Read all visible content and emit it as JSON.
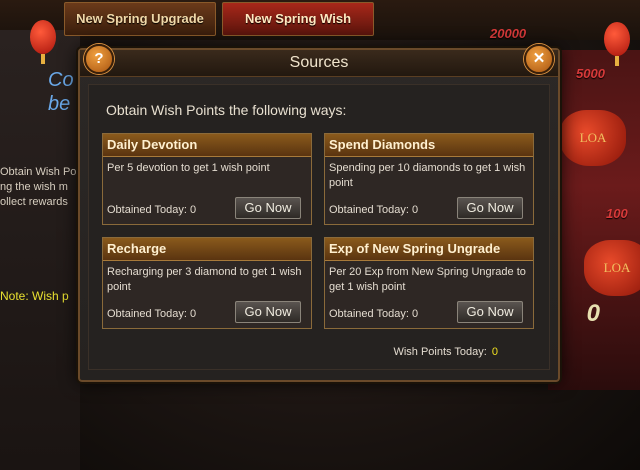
{
  "tabs": [
    {
      "label": "New Spring Upgrade"
    },
    {
      "label": "New Spring Wish"
    }
  ],
  "background": {
    "top_number": "20000",
    "side_number_1": "5000",
    "side_number_2": "100",
    "big_zero": "0",
    "bag_label": "LOA",
    "co_line1": "Co",
    "co_line2": "be",
    "left_text_1": "Obtain Wish Po",
    "left_text_2": "ng the wish m",
    "left_text_3": "ollect rewards",
    "note": "Note: Wish p"
  },
  "dialog": {
    "title": "Sources",
    "help_label": "?",
    "close_label": "✕",
    "subtitle": "Obtain Wish Points the following ways:",
    "cards": [
      {
        "title": "Daily Devotion",
        "description": "Per 5 devotion to get 1 wish point",
        "obtained": "Obtained Today: 0",
        "button": "Go Now"
      },
      {
        "title": "Spend Diamonds",
        "description": "Spending per 10 diamonds to get 1 wish point",
        "obtained": "Obtained Today: 0",
        "button": "Go Now"
      },
      {
        "title": "Recharge",
        "description": "Recharging per 3 diamond to get 1 wish point",
        "obtained": "Obtained Today: 0",
        "button": "Go Now"
      },
      {
        "title": "Exp of New Spring Ungrade",
        "description": "Per 20 Exp from New Spring Ungrade to get 1 wish point",
        "obtained": "Obtained Today: 0",
        "button": "Go Now"
      }
    ],
    "wish_points_label": "Wish Points Today:",
    "wish_points_value": "0"
  },
  "colors": {
    "accent_gold": "#8a5a1c",
    "highlight_yellow": "#f0e020",
    "tab_active": "#a8281a"
  }
}
